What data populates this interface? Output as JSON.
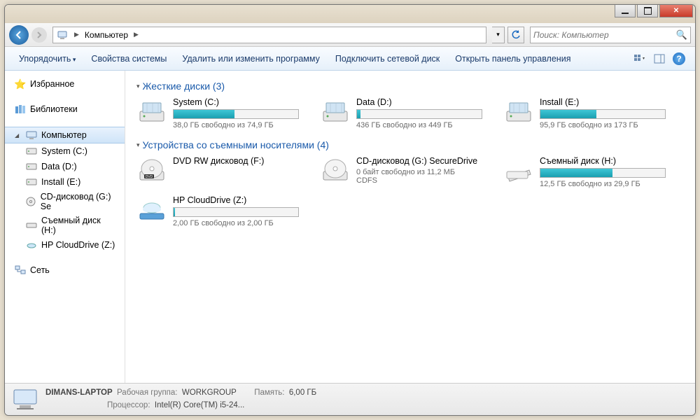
{
  "breadcrumb": {
    "root": "Компьютер"
  },
  "search": {
    "placeholder": "Поиск: Компьютер"
  },
  "toolbar": {
    "organize": "Упорядочить",
    "props": "Свойства системы",
    "uninstall": "Удалить или изменить программу",
    "mapnet": "Подключить сетевой диск",
    "cpanel": "Открыть панель управления"
  },
  "sidebar": {
    "favorites": "Избранное",
    "libraries": "Библиотеки",
    "computer": "Компьютер",
    "network": "Сеть",
    "drives": [
      {
        "label": "System (C:)"
      },
      {
        "label": "Data (D:)"
      },
      {
        "label": "Install (E:)"
      },
      {
        "label": "CD-дисковод (G:) Se"
      },
      {
        "label": "Съемный диск (H:)"
      },
      {
        "label": "HP CloudDrive (Z:)"
      }
    ]
  },
  "sections": {
    "hdd": "Жесткие диски (3)",
    "removable": "Устройства со съемными носителями (4)"
  },
  "hdd": [
    {
      "name": "System (C:)",
      "stat": "38,0 ГБ свободно из 74,9 ГБ",
      "fill": 49
    },
    {
      "name": "Data (D:)",
      "stat": "436 ГБ свободно из 449 ГБ",
      "fill": 3
    },
    {
      "name": "Install (E:)",
      "stat": "95,9 ГБ свободно из 173 ГБ",
      "fill": 45
    }
  ],
  "removable": [
    {
      "name": "DVD RW дисковод (F:)",
      "stat": "",
      "type": "dvd"
    },
    {
      "name": "CD-дисковод (G:) SecureDrive",
      "stat": "0 байт свободно из 11,2 МБ",
      "extra": "CDFS",
      "type": "cd"
    },
    {
      "name": "Съемный диск (H:)",
      "stat": "12,5 ГБ свободно из 29,9 ГБ",
      "fill": 58,
      "type": "usb"
    },
    {
      "name": "HP CloudDrive (Z:)",
      "stat": "2,00 ГБ свободно из 2,00 ГБ",
      "fill": 1,
      "type": "cloud"
    }
  ],
  "status": {
    "hostname": "DIMANS-LAPTOP",
    "workgroup_label": "Рабочая группа:",
    "workgroup": "WORKGROUP",
    "cpu_label": "Процессор:",
    "cpu": "Intel(R) Core(TM) i5-24...",
    "ram_label": "Память:",
    "ram": "6,00 ГБ"
  }
}
